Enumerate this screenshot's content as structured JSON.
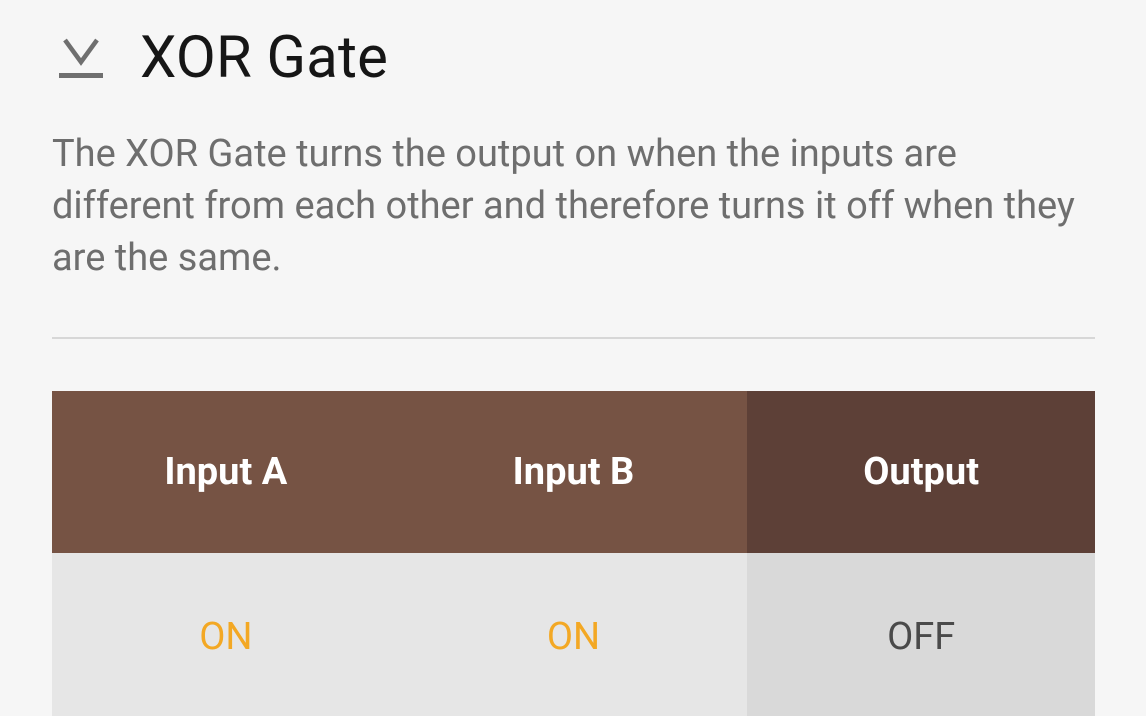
{
  "header": {
    "title": "XOR Gate",
    "icon": "xor-gate-symbol-icon"
  },
  "description": "The XOR Gate turns the output on when the inputs are different from each other and therefore turns it off when they are the same.",
  "truth_table": {
    "columns": [
      "Input A",
      "Input B",
      "Output"
    ],
    "rows": [
      [
        "ON",
        "ON",
        "OFF"
      ]
    ]
  },
  "colors": {
    "input_header": "#765344",
    "output_header": "#5d4037",
    "on_value": "#f3a824",
    "off_value": "#4a4a4a"
  }
}
